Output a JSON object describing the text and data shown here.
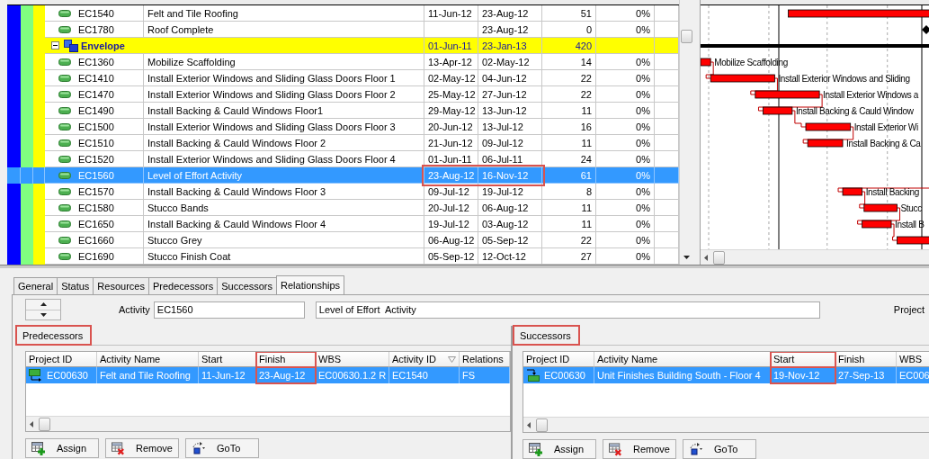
{
  "schedule": {
    "rows": [
      {
        "kind": "activity",
        "id": "EC1540",
        "name": "Felt and Tile Roofing",
        "start": "11-Jun-12",
        "finish": "23-Aug-12",
        "duration": "51",
        "complete": "0%",
        "selected": false,
        "highlighted": false
      },
      {
        "kind": "milestone",
        "id": "EC1780",
        "name": "Roof Complete",
        "finish": "23-Aug-12",
        "duration": "0",
        "complete": "0%",
        "selected": false,
        "highlighted": false
      },
      {
        "kind": "wbs",
        "name": "Envelope",
        "start": "01-Jun-11",
        "finish": "23-Jan-13",
        "duration": "420",
        "expanded": true,
        "selected": false,
        "children": [
          {
            "kind": "activity",
            "id": "EC1360",
            "name": "Mobilize Scaffolding",
            "start": "13-Apr-12",
            "finish": "02-May-12",
            "duration": "14",
            "complete": "0%",
            "selected": false,
            "highlighted": false,
            "gantt_label": "Mobilize Scaffolding"
          },
          {
            "kind": "activity",
            "id": "EC1410",
            "name": "Install Exterior Windows and Sliding Glass Doors Floor 1",
            "start": "02-May-12",
            "finish": "04-Jun-12",
            "duration": "22",
            "complete": "0%",
            "selected": false,
            "highlighted": false,
            "gantt_label": "Install Exterior Windows and Sliding"
          },
          {
            "kind": "activity",
            "id": "EC1470",
            "name": "Install Exterior Windows and Sliding Glass Doors Floor 2",
            "start": "25-May-12",
            "finish": "27-Jun-12",
            "duration": "22",
            "complete": "0%",
            "selected": false,
            "highlighted": false,
            "gantt_label": "Install Exterior Windows a"
          },
          {
            "kind": "activity",
            "id": "EC1490",
            "name": "Install Backing & Cauld Windows Floor1",
            "start": "29-May-12",
            "finish": "13-Jun-12",
            "duration": "11",
            "complete": "0%",
            "selected": false,
            "highlighted": false,
            "gantt_label": "Install Backing & Cauld Window"
          },
          {
            "kind": "activity",
            "id": "EC1500",
            "name": "Install Exterior Windows and Sliding Glass Doors Floor 3",
            "start": "20-Jun-12",
            "finish": "13-Jul-12",
            "duration": "16",
            "complete": "0%",
            "selected": false,
            "highlighted": false,
            "gantt_label": "Install Exterior Wi"
          },
          {
            "kind": "activity",
            "id": "EC1510",
            "name": "Install Backing & Cauld Windows Floor 2",
            "start": "21-Jun-12",
            "finish": "09-Jul-12",
            "duration": "11",
            "complete": "0%",
            "selected": false,
            "highlighted": false,
            "gantt_label": "Install Backing & Ca"
          },
          {
            "kind": "activity",
            "id": "EC1520",
            "name": "Install Exterior Windows and Sliding Glass Doors Floor 4",
            "start": "01-Jun-11",
            "finish": "06-Jul-11",
            "duration": "24",
            "complete": "0%",
            "selected": false,
            "highlighted": false
          },
          {
            "kind": "activity",
            "id": "EC1560",
            "name": "Level of Effort  Activity",
            "start": "23-Aug-12",
            "finish": "16-Nov-12",
            "duration": "61",
            "complete": "0%",
            "selected": true,
            "highlighted": true
          },
          {
            "kind": "activity",
            "id": "EC1570",
            "name": "Install Backing & Cauld Windows Floor 3",
            "start": "09-Jul-12",
            "finish": "19-Jul-12",
            "duration": "8",
            "complete": "0%",
            "selected": false,
            "highlighted": false,
            "gantt_label": "Install Backing"
          },
          {
            "kind": "activity",
            "id": "EC1580",
            "name": "Stucco Bands",
            "start": "20-Jul-12",
            "finish": "06-Aug-12",
            "duration": "11",
            "complete": "0%",
            "selected": false,
            "highlighted": false,
            "gantt_label": "Stucc"
          },
          {
            "kind": "activity",
            "id": "EC1650",
            "name": "Install Backing & Cauld Windows Floor 4",
            "start": "19-Jul-12",
            "finish": "03-Aug-12",
            "duration": "11",
            "complete": "0%",
            "selected": false,
            "highlighted": false,
            "gantt_label": "Install B"
          },
          {
            "kind": "activity",
            "id": "EC1660",
            "name": "Stucco Grey",
            "start": "06-Aug-12",
            "finish": "05-Sep-12",
            "duration": "22",
            "complete": "0%",
            "selected": false,
            "highlighted": false
          },
          {
            "kind": "activity",
            "id": "EC1690",
            "name": "Stucco Finish Coat",
            "start": "05-Sep-12",
            "finish": "12-Oct-12",
            "duration": "27",
            "complete": "0%",
            "selected": false,
            "highlighted": false
          }
        ]
      }
    ]
  },
  "detail": {
    "tabs": [
      {
        "label": "General",
        "selected": false
      },
      {
        "label": "Status",
        "selected": false
      },
      {
        "label": "Resources",
        "selected": false
      },
      {
        "label": "Predecessors",
        "selected": false
      },
      {
        "label": "Successors",
        "selected": false
      },
      {
        "label": "Relationships",
        "selected": true
      }
    ],
    "activity_label": "Activity",
    "activity_id": "EC1560",
    "activity_name": "Level of Effort  Activity",
    "project_label": "Project",
    "panels": [
      {
        "kind": "predecessor",
        "title": "Predecessors",
        "highlighted": true,
        "columns": [
          {
            "label": "Project ID",
            "highlighted": false,
            "sorted": false
          },
          {
            "label": "Activity Name",
            "highlighted": false,
            "sorted": false
          },
          {
            "label": "Start",
            "highlighted": false,
            "sorted": false
          },
          {
            "label": "Finish",
            "highlighted": true,
            "sorted": false
          },
          {
            "label": "WBS",
            "highlighted": false,
            "sorted": false
          },
          {
            "label": "Activity ID",
            "highlighted": false,
            "sorted": true
          },
          {
            "label": "Relations",
            "highlighted": false,
            "sorted": false
          }
        ],
        "rows": [
          {
            "selected": true,
            "cells": [
              "EC00630",
              "Felt and Tile Roofing",
              "11-Jun-12",
              "23-Aug-12",
              "EC00630.1.2 R",
              "EC1540",
              "FS"
            ]
          }
        ],
        "buttons": [
          {
            "kind": "assign",
            "label": "Assign"
          },
          {
            "kind": "remove",
            "label": "Remove"
          },
          {
            "kind": "goto",
            "label": "GoTo"
          }
        ]
      },
      {
        "kind": "successor",
        "title": "Successors",
        "highlighted": true,
        "columns": [
          {
            "label": "Project ID",
            "highlighted": false,
            "sorted": false
          },
          {
            "label": "Activity Name",
            "highlighted": false,
            "sorted": false
          },
          {
            "label": "Start",
            "highlighted": true,
            "sorted": false
          },
          {
            "label": "Finish",
            "highlighted": false,
            "sorted": false
          },
          {
            "label": "WBS",
            "highlighted": false,
            "sorted": false
          }
        ],
        "rows": [
          {
            "selected": true,
            "cells": [
              "EC00630",
              "Unit Finishes Building South - Floor 4",
              "19-Nov-12",
              "27-Sep-13",
              "EC006"
            ]
          }
        ],
        "buttons": [
          {
            "kind": "assign",
            "label": "Assign"
          },
          {
            "kind": "remove",
            "label": "Remove"
          },
          {
            "kind": "goto",
            "label": "GoTo"
          }
        ]
      }
    ]
  }
}
